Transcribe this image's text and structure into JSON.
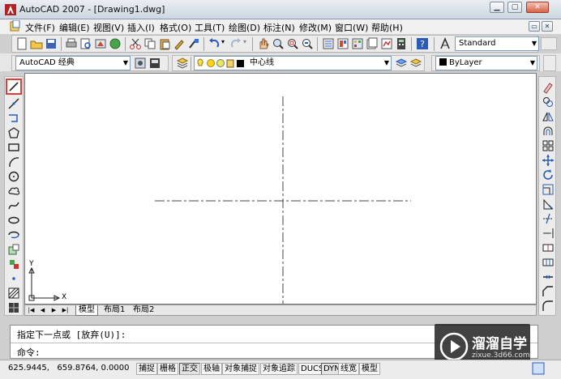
{
  "window": {
    "title": "AutoCAD 2007 - [Drawing1.dwg]"
  },
  "menu": {
    "items": [
      "文件(F)",
      "编辑(E)",
      "视图(V)",
      "插入(I)",
      "格式(O)",
      "工具(T)",
      "绘图(D)",
      "标注(N)",
      "修改(M)",
      "窗口(W)",
      "帮助(H)"
    ]
  },
  "toolbar": {
    "text_style": "Standard",
    "workspace": "AutoCAD 经典",
    "layer": "中心线",
    "color": "ByLayer"
  },
  "layout_tabs": [
    "模型",
    "布局1",
    "布局2"
  ],
  "axis_labels": {
    "y": "Y",
    "x": "X"
  },
  "command": {
    "line1": "指定下一点或 [放弃(U)]:",
    "line2": "命令:"
  },
  "status": {
    "coords": "625.9445,   659.8764, 0.0000",
    "toggles": [
      "捕捉",
      "栅格",
      "正交",
      "极轴",
      "对象捕捉",
      "对象追踪",
      "DUCS",
      "DYN",
      "线宽",
      "模型"
    ]
  },
  "watermark": {
    "brand": "溜溜自学",
    "url": "zixue.3d66.com"
  },
  "colors": {
    "canvas": "#ffffff",
    "line_accent": "#3a6fd8",
    "selected_tool_border": "#e03c3c"
  }
}
